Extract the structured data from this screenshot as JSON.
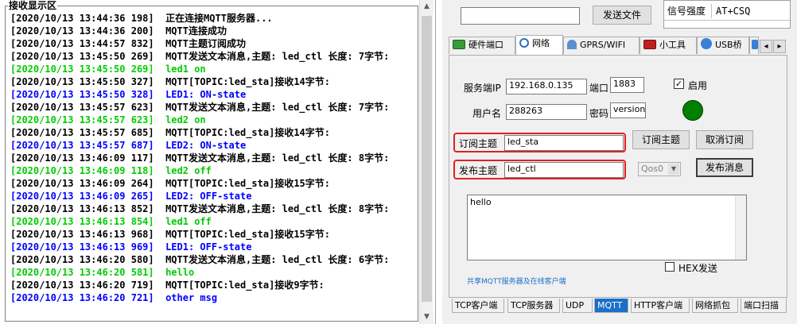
{
  "receive": {
    "title": "接收显示区",
    "lines": [
      {
        "text": "[2020/10/13 13:44:36 198]  正在连接MQTT服务器...",
        "color": "#000000"
      },
      {
        "text": "[2020/10/13 13:44:36 200]  MQTT连接成功",
        "color": "#000000"
      },
      {
        "text": "[2020/10/13 13:44:57 832]  MQTT主题订阅成功",
        "color": "#000000"
      },
      {
        "text": "[2020/10/13 13:45:50 269]  MQTT发送文本消息,主题: led_ctl 长度: 7字节:",
        "color": "#000000"
      },
      {
        "text": "[2020/10/13 13:45:50 269]  led1 on",
        "color": "#00cc00"
      },
      {
        "text": "[2020/10/13 13:45:50 327]  MQTT[TOPIC:led_sta]接收14字节:",
        "color": "#000000"
      },
      {
        "text": "[2020/10/13 13:45:50 328]  LED1: ON-state",
        "color": "#0000ff"
      },
      {
        "text": "[2020/10/13 13:45:57 623]  MQTT发送文本消息,主题: led_ctl 长度: 7字节:",
        "color": "#000000"
      },
      {
        "text": "[2020/10/13 13:45:57 623]  led2 on",
        "color": "#00cc00"
      },
      {
        "text": "[2020/10/13 13:45:57 685]  MQTT[TOPIC:led_sta]接收14字节:",
        "color": "#000000"
      },
      {
        "text": "[2020/10/13 13:45:57 687]  LED2: ON-state",
        "color": "#0000ff"
      },
      {
        "text": "[2020/10/13 13:46:09 117]  MQTT发送文本消息,主题: led_ctl 长度: 8字节:",
        "color": "#000000"
      },
      {
        "text": "[2020/10/13 13:46:09 118]  led2 off",
        "color": "#00cc00"
      },
      {
        "text": "[2020/10/13 13:46:09 264]  MQTT[TOPIC:led_sta]接收15字节:",
        "color": "#000000"
      },
      {
        "text": "[2020/10/13 13:46:09 265]  LED2: OFF-state",
        "color": "#0000ff"
      },
      {
        "text": "[2020/10/13 13:46:13 852]  MQTT发送文本消息,主题: led_ctl 长度: 8字节:",
        "color": "#000000"
      },
      {
        "text": "[2020/10/13 13:46:13 854]  led1 off",
        "color": "#00cc00"
      },
      {
        "text": "[2020/10/13 13:46:13 968]  MQTT[TOPIC:led_sta]接收15字节:",
        "color": "#000000"
      },
      {
        "text": "[2020/10/13 13:46:13 969]  LED1: OFF-state",
        "color": "#0000ff"
      },
      {
        "text": "[2020/10/13 13:46:20 580]  MQTT发送文本消息,主题: led_ctl 长度: 6字节:",
        "color": "#000000"
      },
      {
        "text": "[2020/10/13 13:46:20 581]  hello",
        "color": "#00cc00"
      },
      {
        "text": "[2020/10/13 13:46:20 719]  MQTT[TOPIC:led_sta]接收9字节:",
        "color": "#000000"
      },
      {
        "text": "[2020/10/13 13:46:20 721]  other msg",
        "color": "#0000ff"
      }
    ]
  },
  "top": {
    "send_file_label": "发送文件",
    "signal_label": "信号强度",
    "signal_value": "AT+CSQ"
  },
  "tabs": {
    "hardware": "硬件端口",
    "network": "网络",
    "gprs": "GPRS/WIFI",
    "tools": "小工具",
    "usb": "USB桥",
    "scroll_left": "◂",
    "scroll_right": "▸"
  },
  "mqtt": {
    "server_ip_label": "服务端IP",
    "server_ip_value": "192.168.0.135",
    "port_label": "端口",
    "port_value": "1883",
    "enable_label": "启用",
    "enable_checked": true,
    "username_label": "用户名",
    "username_value": "288263",
    "password_label": "密码",
    "password_value": "version:",
    "status_color": "#008000",
    "subscribe_label": "订阅主题",
    "subscribe_value": "led_sta",
    "subscribe_button": "订阅主题",
    "unsubscribe_button": "取消订阅",
    "publish_label": "发布主题",
    "publish_value": "led_ctl",
    "qos_value": "Qos0",
    "publish_button": "发布消息",
    "message_text": "hello",
    "hex_label": "HEX发送",
    "share_link": "共享MQTT服务器及在线客户端"
  },
  "bottom_tabs": {
    "tcp_client": "TCP客户端",
    "tcp_server": "TCP服务器",
    "udp": "UDP",
    "mqtt": "MQTT",
    "http_client": "HTTP客户端",
    "capture": "网络抓包",
    "port_scan": "端口扫描"
  },
  "colors": {
    "accent_blue": "#1a6fc9",
    "highlight_red": "#e02020"
  }
}
